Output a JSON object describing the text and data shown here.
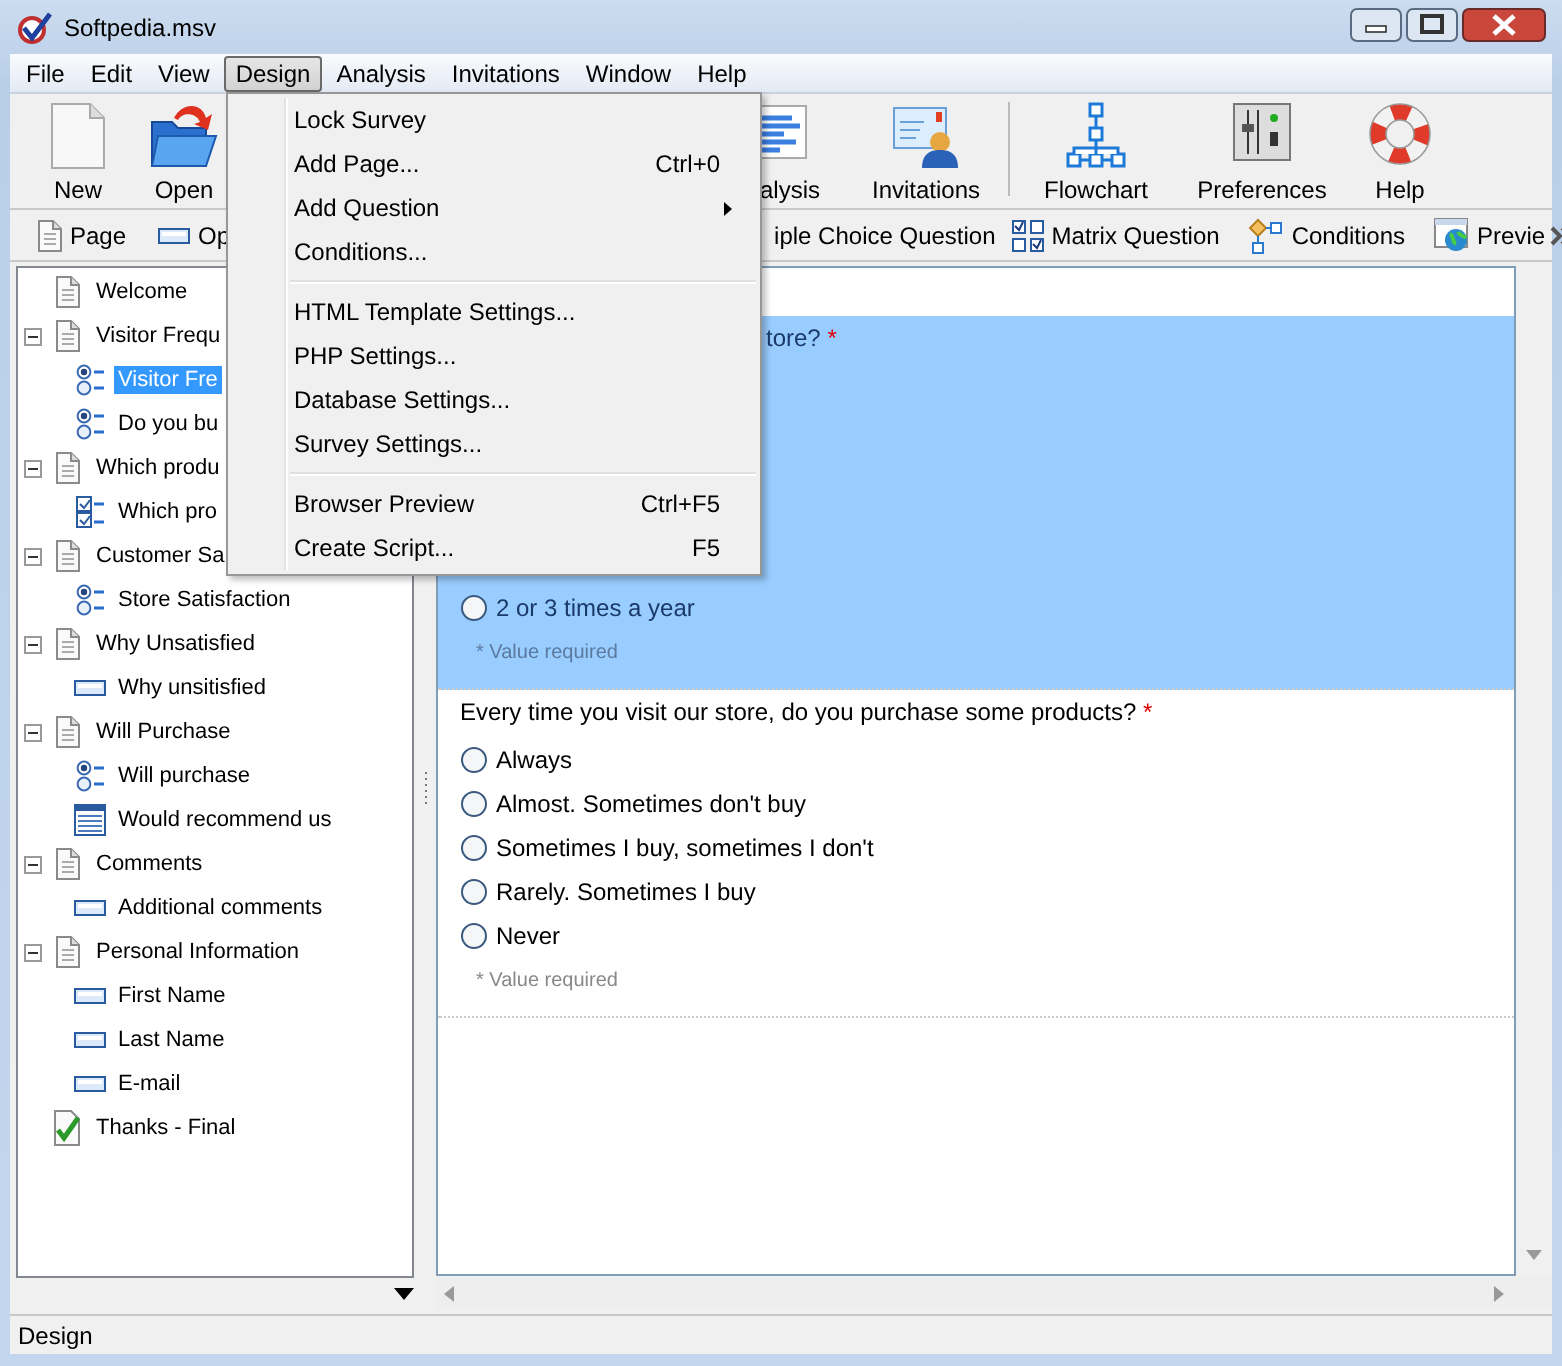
{
  "window": {
    "title": "Softpedia.msv"
  },
  "menu_bar": [
    {
      "label": "File",
      "selected": false
    },
    {
      "label": "Edit",
      "selected": false
    },
    {
      "label": "View",
      "selected": false
    },
    {
      "label": "Design",
      "selected": true
    },
    {
      "label": "Analysis",
      "selected": false
    },
    {
      "label": "Invitations",
      "selected": false
    },
    {
      "label": "Window",
      "selected": false
    },
    {
      "label": "Help",
      "selected": false
    }
  ],
  "toolbar": [
    {
      "kind": "new",
      "label": "New"
    },
    {
      "kind": "open",
      "label": "Open"
    },
    {
      "kind": "analysis",
      "label": "alysis"
    },
    {
      "kind": "invitations",
      "label": "Invitations"
    },
    {
      "kind": "flowchart",
      "label": "Flowchart"
    },
    {
      "kind": "preferences",
      "label": "Preferences"
    },
    {
      "kind": "help",
      "label": "Help"
    }
  ],
  "question_toolbar": [
    {
      "kind": "page",
      "label": "Page"
    },
    {
      "kind": "textfield",
      "label": "Op"
    },
    {
      "kind": "multiple",
      "label": "iple Choice Question"
    },
    {
      "kind": "matrix",
      "label": "Matrix Question"
    },
    {
      "kind": "conditions",
      "label": "Conditions"
    },
    {
      "kind": "preview",
      "label": "Previe"
    }
  ],
  "tree": [
    {
      "kind": "page",
      "label": "Welcome",
      "selected": false
    },
    {
      "kind": "page",
      "label": "Visitor Frequ",
      "selected": false,
      "expanded": true,
      "children": [
        {
          "kind": "radio",
          "label": "Visitor Fre",
          "selected": true
        },
        {
          "kind": "radio",
          "label": "Do you bu",
          "selected": false
        }
      ]
    },
    {
      "kind": "page",
      "label": "Which produ",
      "selected": false,
      "expanded": true,
      "children": [
        {
          "kind": "checkbox",
          "label": "Which pro",
          "selected": false
        }
      ]
    },
    {
      "kind": "page",
      "label": "Customer Sa",
      "selected": false,
      "expanded": true,
      "children": [
        {
          "kind": "radio",
          "label": "Store Satisfaction",
          "selected": false
        }
      ]
    },
    {
      "kind": "page",
      "label": "Why Unsatisfied",
      "selected": false,
      "expanded": true,
      "children": [
        {
          "kind": "text",
          "label": "Why unsitisfied",
          "selected": false
        }
      ]
    },
    {
      "kind": "page",
      "label": "Will Purchase",
      "selected": false,
      "expanded": true,
      "children": [
        {
          "kind": "radio",
          "label": "Will purchase",
          "selected": false
        },
        {
          "kind": "list",
          "label": "Would recommend us",
          "selected": false
        }
      ]
    },
    {
      "kind": "page",
      "label": "Comments",
      "selected": false,
      "expanded": true,
      "children": [
        {
          "kind": "text",
          "label": "Additional comments",
          "selected": false
        }
      ]
    },
    {
      "kind": "page",
      "label": "Personal Information",
      "selected": false,
      "expanded": true,
      "children": [
        {
          "kind": "text",
          "label": "First Name",
          "selected": false
        },
        {
          "kind": "text",
          "label": "Last Name",
          "selected": false
        },
        {
          "kind": "text",
          "label": "E-mail",
          "selected": false
        }
      ]
    },
    {
      "kind": "final",
      "label": "Thanks - Final",
      "selected": false
    }
  ],
  "questions": [
    {
      "text": "tore?",
      "required_mark": "*",
      "selected": true,
      "options": [
        {
          "label": "2 or 3 times a year",
          "checked": false
        }
      ],
      "note": "* Value required"
    },
    {
      "text": "Every time you visit our store, do you purchase some products?",
      "required_mark": "*",
      "selected": false,
      "options": [
        {
          "label": "Always",
          "checked": false
        },
        {
          "label": "Almost. Sometimes don't buy",
          "checked": false
        },
        {
          "label": "Sometimes I buy, sometimes I don't",
          "checked": false
        },
        {
          "label": "Rarely. Sometimes I buy",
          "checked": false
        },
        {
          "label": "Never",
          "checked": false
        }
      ],
      "note": "* Value required"
    }
  ],
  "design_menu": [
    {
      "kind": "item",
      "label": "Lock Survey"
    },
    {
      "kind": "item",
      "label": "Add Page...",
      "shortcut": "Ctrl+0"
    },
    {
      "kind": "submenu",
      "label": "Add Question"
    },
    {
      "kind": "item",
      "label": "Conditions..."
    },
    {
      "kind": "separator"
    },
    {
      "kind": "item",
      "label": "HTML Template Settings..."
    },
    {
      "kind": "item",
      "label": "PHP Settings..."
    },
    {
      "kind": "item",
      "label": "Database Settings..."
    },
    {
      "kind": "item",
      "label": "Survey Settings..."
    },
    {
      "kind": "separator"
    },
    {
      "kind": "item",
      "label": "Browser Preview",
      "shortcut": "Ctrl+F5"
    },
    {
      "kind": "item",
      "label": "Create Script...",
      "shortcut": "F5"
    }
  ],
  "status_bar": {
    "text": "Design"
  }
}
